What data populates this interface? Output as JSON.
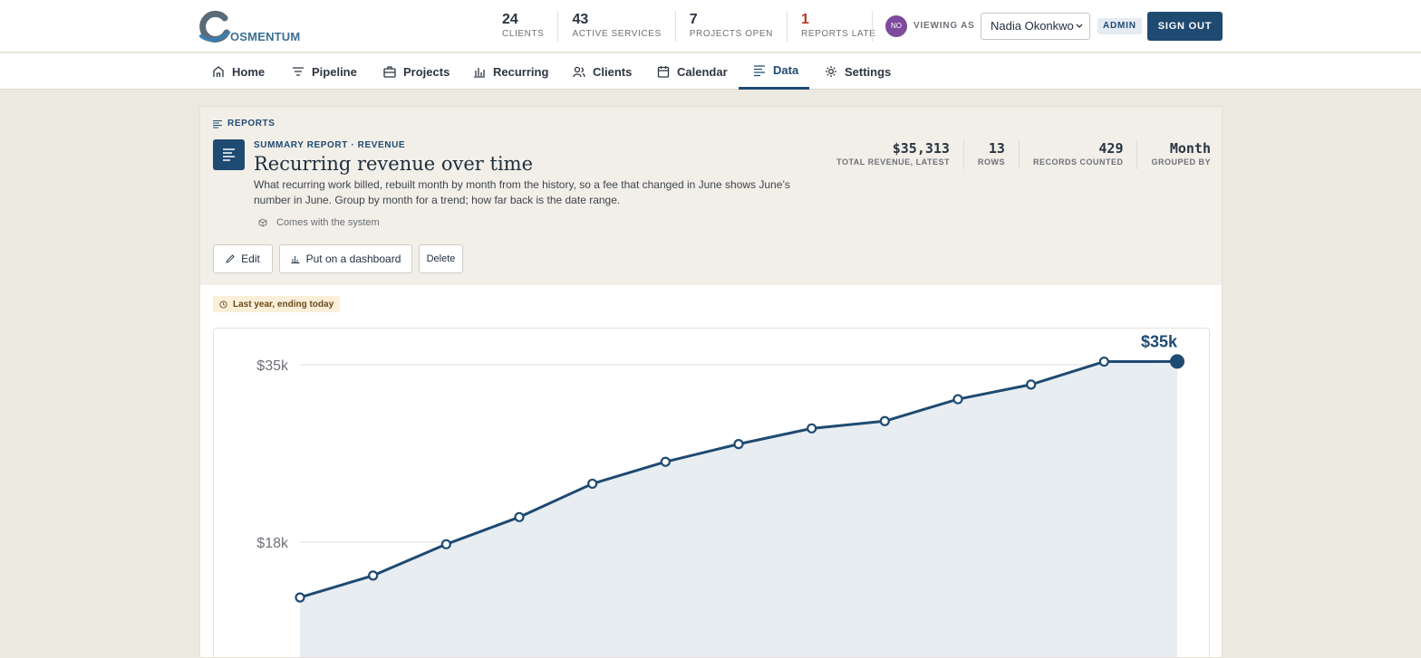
{
  "brand": {
    "name": "OSMENTUM",
    "accent": "#1f4a72"
  },
  "header": {
    "stats": [
      {
        "value": "24",
        "label": "CLIENTS"
      },
      {
        "value": "43",
        "label": "ACTIVE SERVICES"
      },
      {
        "value": "7",
        "label": "PROJECTS OPEN"
      },
      {
        "value": "1",
        "label": "REPORTS LATE"
      }
    ],
    "avatar_initials": "NO",
    "viewing_as_label": "VIEWING AS",
    "viewing_as_user": "Nadia Okonkwo",
    "role_badge": "ADMIN",
    "sign_out_label": "SIGN OUT"
  },
  "nav": {
    "items": [
      {
        "label": "Home",
        "icon": "home-icon"
      },
      {
        "label": "Pipeline",
        "icon": "filter-icon"
      },
      {
        "label": "Projects",
        "icon": "briefcase-icon"
      },
      {
        "label": "Recurring",
        "icon": "bar-chart-icon"
      },
      {
        "label": "Clients",
        "icon": "users-icon"
      },
      {
        "label": "Calendar",
        "icon": "calendar-icon"
      },
      {
        "label": "Data",
        "icon": "lines-icon",
        "active": true
      },
      {
        "label": "Settings",
        "icon": "gear-icon"
      }
    ]
  },
  "report": {
    "breadcrumb": "REPORTS",
    "eyebrow": "SUMMARY REPORT · REVENUE",
    "title": "Recurring revenue over time",
    "description": "What recurring work billed, rebuilt month by month from the history, so a fee that changed in June shows June’s number in June. Group by month for a trend; how far back is the date range.",
    "origin": "Comes with the system",
    "buttons": {
      "edit": "Edit",
      "dashboard": "Put on a dashboard",
      "delete": "Delete"
    },
    "kpis": [
      {
        "value": "$35,313",
        "label": "TOTAL REVENUE, LATEST"
      },
      {
        "value": "13",
        "label": "ROWS"
      },
      {
        "value": "429",
        "label": "RECORDS COUNTED"
      },
      {
        "value": "Month",
        "label": "GROUPED BY"
      }
    ],
    "range_badge": "Last year, ending today"
  },
  "chart_data": {
    "type": "area",
    "title": "",
    "xlabel": "",
    "ylabel": "",
    "y_tick_labels": [
      "$18k",
      "$35k"
    ],
    "y_ticks": [
      18000,
      35000
    ],
    "ylim": [
      0,
      35313
    ],
    "grid": true,
    "line_color": "#1f4a72",
    "fill_color": "#e8edf2",
    "last_point_label": "$35k",
    "series": [
      {
        "values": [
          12700,
          14800,
          17800,
          20400,
          23600,
          25700,
          27400,
          28900,
          29600,
          31700,
          33100,
          35300,
          35313
        ]
      }
    ]
  }
}
